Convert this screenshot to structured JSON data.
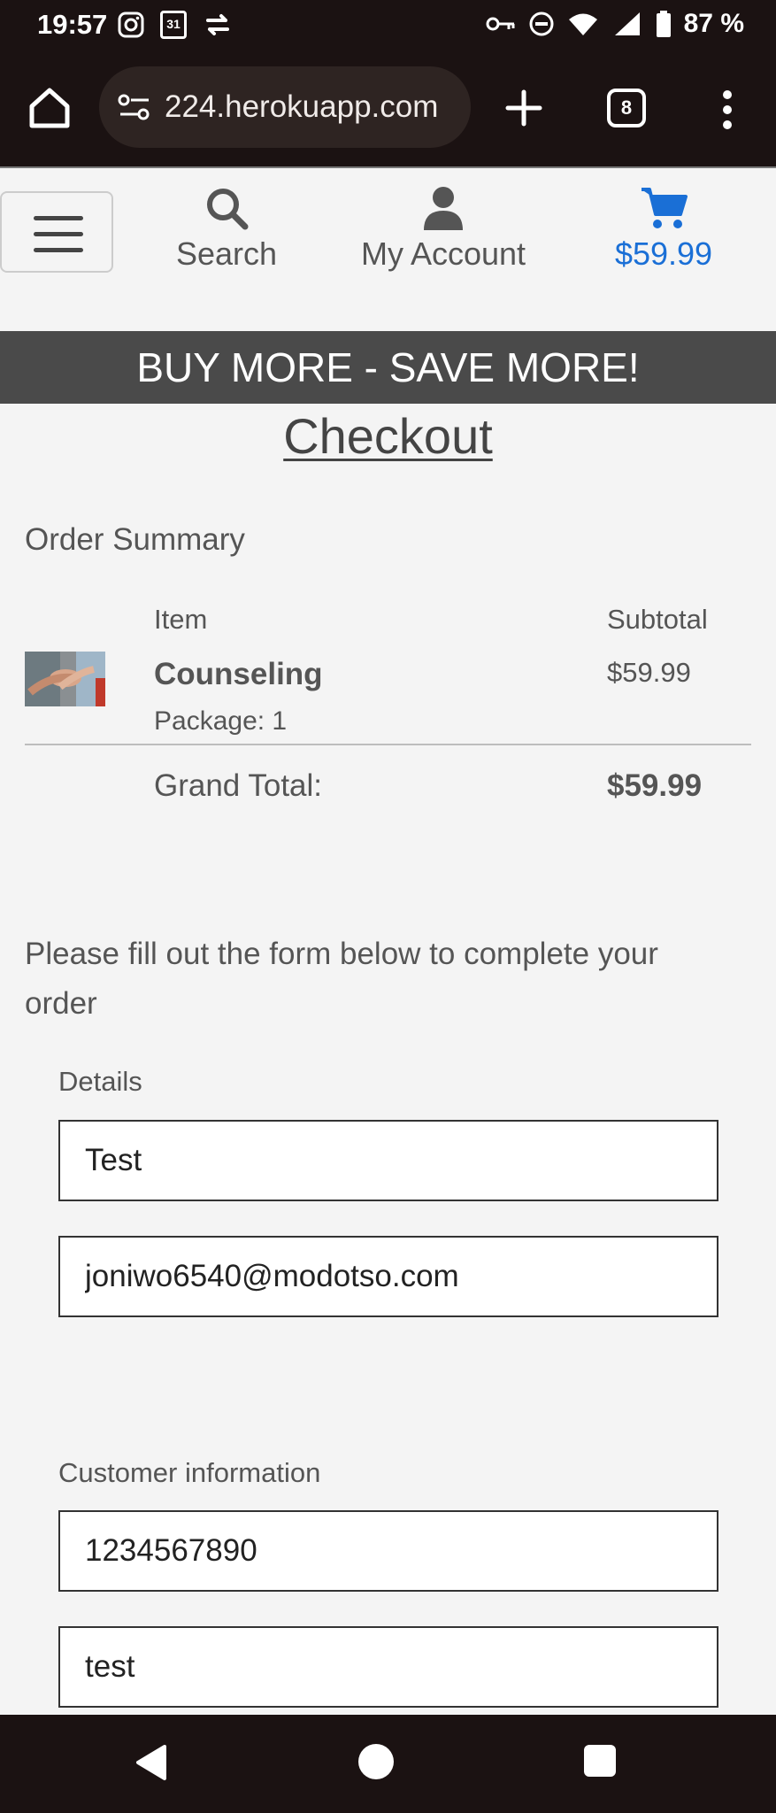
{
  "status_bar": {
    "time": "19:57",
    "calendar_day": "31",
    "battery": "87 %"
  },
  "browser": {
    "url": "224.herokuapp.com",
    "tab_count": "8"
  },
  "header": {
    "search_label": "Search",
    "account_label": "My Account",
    "cart_total": "$59.99",
    "accent_color": "#1a6fd6"
  },
  "banner": {
    "text": "BUY MORE - SAVE MORE!"
  },
  "page": {
    "title": "Checkout"
  },
  "order_summary": {
    "title": "Order Summary",
    "col_item": "Item",
    "col_subtotal": "Subtotal",
    "items": [
      {
        "name": "Counseling",
        "package": "Package: 1",
        "subtotal": "$59.99"
      }
    ],
    "grand_total_label": "Grand Total:",
    "grand_total_value": "$59.99"
  },
  "form": {
    "instructions": "Please fill out the form below to complete your order",
    "details_label": "Details",
    "full_name": "Test",
    "email": "joniwo6540@modotso.com",
    "customer_info_label": "Customer information",
    "phone": "1234567890",
    "address": "test"
  }
}
